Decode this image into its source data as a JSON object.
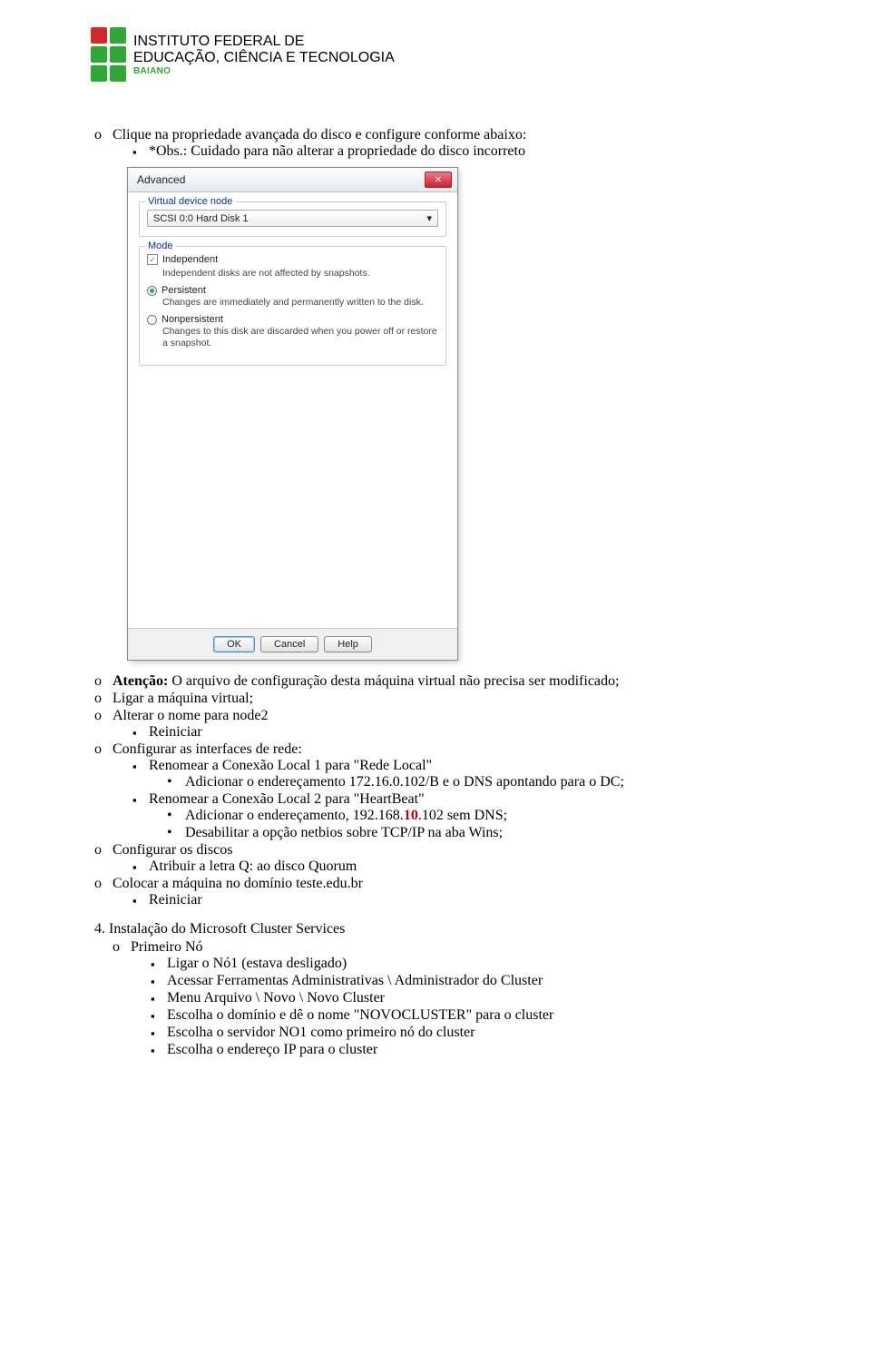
{
  "logo": {
    "line1": "INSTITUTO FEDERAL DE",
    "line2": "EDUCAÇÃO, CIÊNCIA E TECNOLOGIA",
    "line3": "BAIANO"
  },
  "intro": {
    "bullet1_prefix": "Clique na propriedade avançada do disco e configure conforme abaixo:",
    "obs": "*Obs.: Cuidado para não alterar a propriedade do disco incorreto"
  },
  "dialog": {
    "title": "Advanced",
    "group1_title": "Virtual device node",
    "combo_value": "SCSI 0:0  Hard Disk 1",
    "group2_title": "Mode",
    "independent_label": "Independent",
    "independent_desc": "Independent disks are not affected by snapshots.",
    "persistent_label": "Persistent",
    "persistent_desc": "Changes are immediately and permanently written to the disk.",
    "nonpersistent_label": "Nonpersistent",
    "nonpersistent_desc": "Changes to this disk are discarded when you power off or restore a snapshot.",
    "ok": "OK",
    "cancel": "Cancel",
    "help": "Help"
  },
  "list": {
    "atencao_label": "Atenção:",
    "atencao_rest": " O arquivo de configuração desta máquina virtual não precisa ser modificado;",
    "ligar": "Ligar a máquina virtual;",
    "alterar": "Alterar o nome para node2",
    "reiniciar": "Reiniciar",
    "configurar_ifaces": "Configurar as interfaces de rede:",
    "ren1": "Renomear a Conexão Local 1 para \"Rede Local\"",
    "end1": "Adicionar o endereçamento 172.16.0.102/B e o DNS apontando para o DC;",
    "ren2": "Renomear a Conexão Local 2 para \"HeartBeat\"",
    "end2_prefix": "Adicionar o endereçamento, 192.168.",
    "end2_red": "10",
    "end2_suffix": ".102 sem DNS;",
    "netbios": "Desabilitar a opção netbios sobre TCP/IP na aba Wins;",
    "conf_discos": "Configurar os discos",
    "quorum": "Atribuir a letra Q: ao disco Quorum",
    "dominio": "Colocar a máquina no domínio teste.edu.br",
    "reiniciar2": "Reiniciar"
  },
  "step4": {
    "title": "Instalação do Microsoft Cluster Services",
    "primeiro_no": "Primeiro Nó",
    "s1": "Ligar o Nó1 (estava desligado)",
    "s2": "Acessar Ferramentas Administrativas \\ Administrador do Cluster",
    "s3": "Menu Arquivo \\ Novo \\ Novo Cluster",
    "s4": "Escolha o domínio e dê o nome \"NOVOCLUSTER\" para o cluster",
    "s5": "Escolha o servidor NO1 como primeiro nó do cluster",
    "s6": "Escolha o endereço IP para o cluster"
  }
}
